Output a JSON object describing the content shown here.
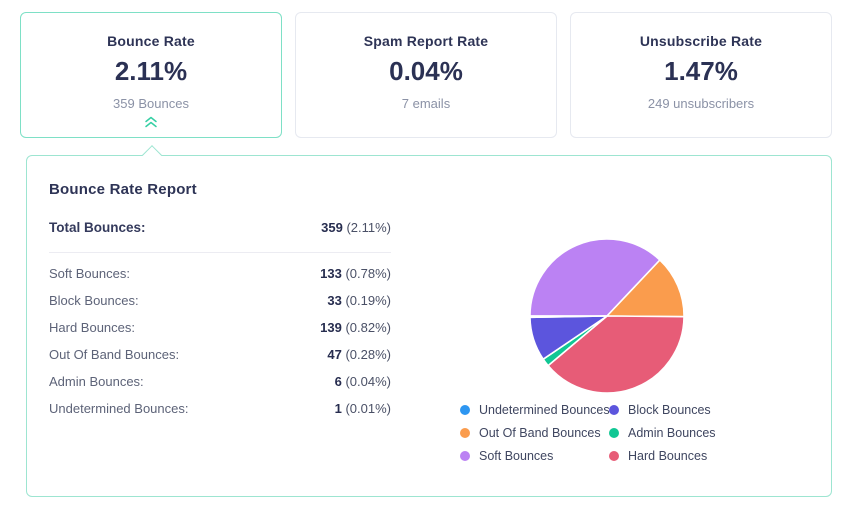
{
  "cards": [
    {
      "title": "Bounce Rate",
      "value": "2.11%",
      "subtitle": "359 Bounces",
      "selected": true
    },
    {
      "title": "Spam Report Rate",
      "value": "0.04%",
      "subtitle": "7 emails",
      "selected": false
    },
    {
      "title": "Unsubscribe Rate",
      "value": "1.47%",
      "subtitle": "249 unsubscribers",
      "selected": false
    }
  ],
  "report": {
    "title": "Bounce Rate Report",
    "total_row": {
      "label": "Total Bounces:",
      "value": "359",
      "pct": "(2.11%)"
    },
    "rows": [
      {
        "label": "Soft Bounces:",
        "value": "133",
        "pct": "(0.78%)"
      },
      {
        "label": "Block Bounces:",
        "value": "33",
        "pct": "(0.19%)"
      },
      {
        "label": "Hard Bounces:",
        "value": "139",
        "pct": "(0.82%)"
      },
      {
        "label": "Out Of Band Bounces:",
        "value": "47",
        "pct": "(0.28%)"
      },
      {
        "label": "Admin Bounces:",
        "value": "6",
        "pct": "(0.04%)"
      },
      {
        "label": "Undetermined Bounces:",
        "value": "1",
        "pct": "(0.01%)"
      }
    ]
  },
  "chart_data": {
    "type": "pie",
    "title": "Bounce Rate Report",
    "total": 359,
    "start_angle_deg": 180,
    "direction": "clockwise",
    "slices": [
      {
        "name": "Soft Bounces",
        "value": 133,
        "pct_of_sends": "0.78%",
        "color": "#bb82f3"
      },
      {
        "name": "Out Of Band Bounces",
        "value": 47,
        "pct_of_sends": "0.28%",
        "color": "#fa9c4d"
      },
      {
        "name": "Hard Bounces",
        "value": 139,
        "pct_of_sends": "0.82%",
        "color": "#e75c77"
      },
      {
        "name": "Admin Bounces",
        "value": 6,
        "pct_of_sends": "0.04%",
        "color": "#10c794"
      },
      {
        "name": "Block Bounces",
        "value": 33,
        "pct_of_sends": "0.19%",
        "color": "#5c55dd"
      },
      {
        "name": "Undetermined Bounces",
        "value": 1,
        "pct_of_sends": "0.01%",
        "color": "#2d96f1"
      }
    ],
    "legend_position": "bottom-right",
    "legend": [
      {
        "label": "Undetermined Bounces",
        "color": "#2d96f1"
      },
      {
        "label": "Block Bounces",
        "color": "#5c55dd"
      },
      {
        "label": "Out Of Band Bounces",
        "color": "#fa9c4d"
      },
      {
        "label": "Admin Bounces",
        "color": "#10c794"
      },
      {
        "label": "Soft Bounces",
        "color": "#bb82f3"
      },
      {
        "label": "Hard Bounces",
        "color": "#e75c77"
      }
    ]
  },
  "colors": {
    "accent_teal": "#35cfa4",
    "selected_card_border": "#7ee0c6",
    "panel_border": "#9de5d1",
    "navy_text": "#2e3456"
  }
}
